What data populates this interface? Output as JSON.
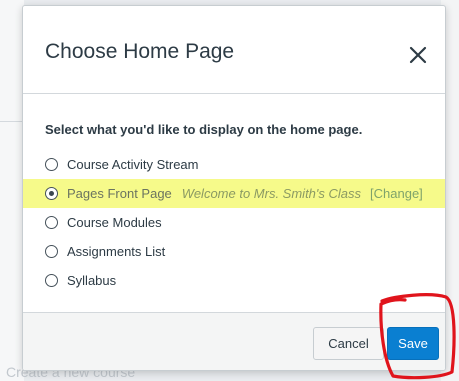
{
  "background": {
    "hint_text": "Create a new course"
  },
  "dialog": {
    "title": "Choose Home Page",
    "prompt": "Select what you'd like to display on the home page.",
    "options": [
      {
        "label": "Course Activity Stream",
        "checked": false
      },
      {
        "label": "Pages Front Page",
        "checked": true,
        "front_page_title": "Welcome to Mrs. Smith's Class",
        "change_label": "[Change]"
      },
      {
        "label": "Course Modules",
        "checked": false
      },
      {
        "label": "Assignments List",
        "checked": false
      },
      {
        "label": "Syllabus",
        "checked": false
      }
    ],
    "cancel_label": "Cancel",
    "save_label": "Save"
  },
  "colors": {
    "highlight": "#f6fa8a",
    "save_button": "#0a7fd1",
    "annotation_circle": "#e0141c"
  },
  "icons": {
    "close": "close-icon"
  }
}
